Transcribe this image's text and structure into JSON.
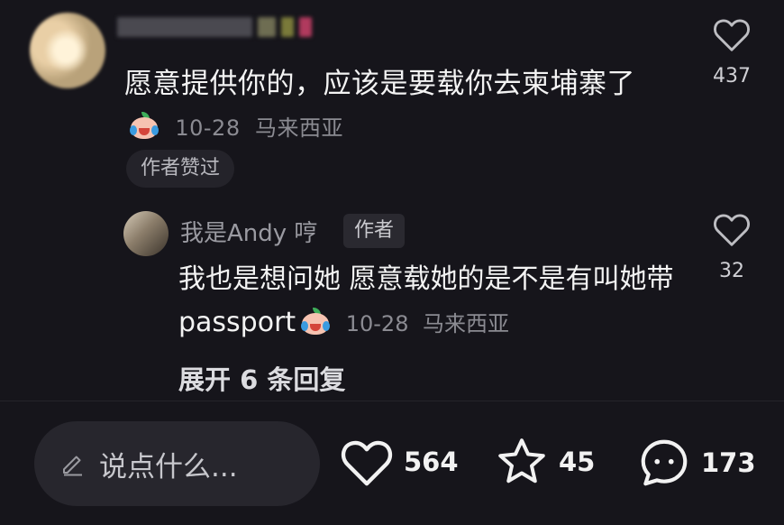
{
  "comment": {
    "text": "愿意提供你的，应该是要载你去柬埔寨了",
    "date": "10-28",
    "location": "马来西亚",
    "like_count": "437",
    "badge": "作者赞过"
  },
  "reply": {
    "username": "我是Andy 哼",
    "author_tag": "作者",
    "text": "我也是想问她 愿意载她的是不是有叫她带passport",
    "date": "10-28",
    "location": "马来西亚",
    "like_count": "32"
  },
  "expand_replies": "展开 6 条回复",
  "bottom_bar": {
    "input_placeholder": "说点什么...",
    "likes": "564",
    "favorites": "45",
    "comments": "173"
  },
  "icons": [
    "heart-icon",
    "star-icon",
    "chat-bubble-icon",
    "pencil-icon",
    "crying-laugh-emoji"
  ]
}
